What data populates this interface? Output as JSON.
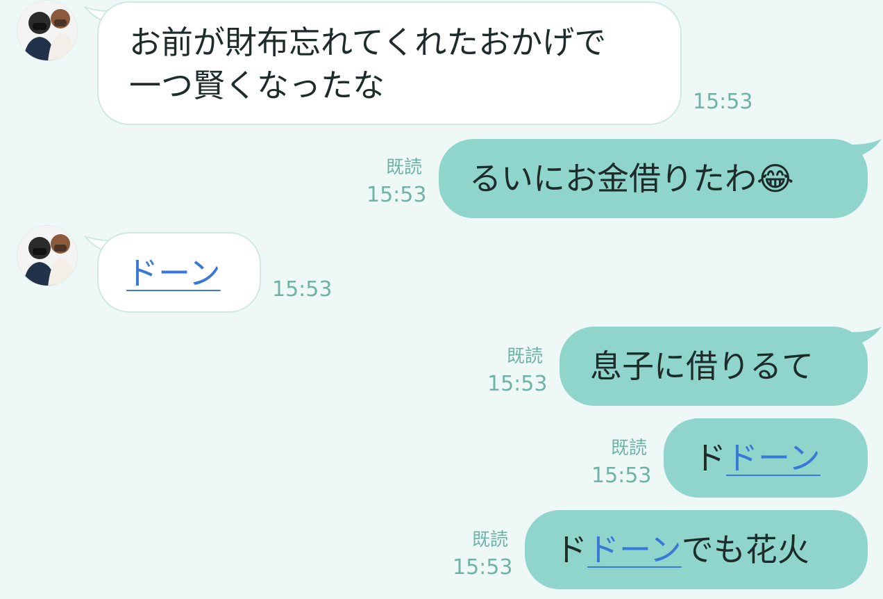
{
  "messages": [
    {
      "text_line1": "お前が財布忘れてくれたおかげで",
      "text_line2": "一つ賢くなったな",
      "time": "15:53"
    },
    {
      "text": "るいにお金借りたわ😂",
      "read": "既読",
      "time": "15:53"
    },
    {
      "link": "ドーン",
      "time": "15:53"
    },
    {
      "text": "息子に借りるて",
      "read": "既読",
      "time": "15:53"
    },
    {
      "prefix": "ド",
      "link": "ドーン",
      "read": "既読",
      "time": "15:53"
    },
    {
      "prefix": "ド",
      "link": "ドーン",
      "suffix": "でも花火",
      "read": "既読",
      "time": "15:53"
    }
  ],
  "colors": {
    "background": "#eef8f6",
    "outgoing": "#8fd5cc",
    "incoming": "#ffffff",
    "meta": "#6fb3a6",
    "link": "#3a78d6"
  }
}
